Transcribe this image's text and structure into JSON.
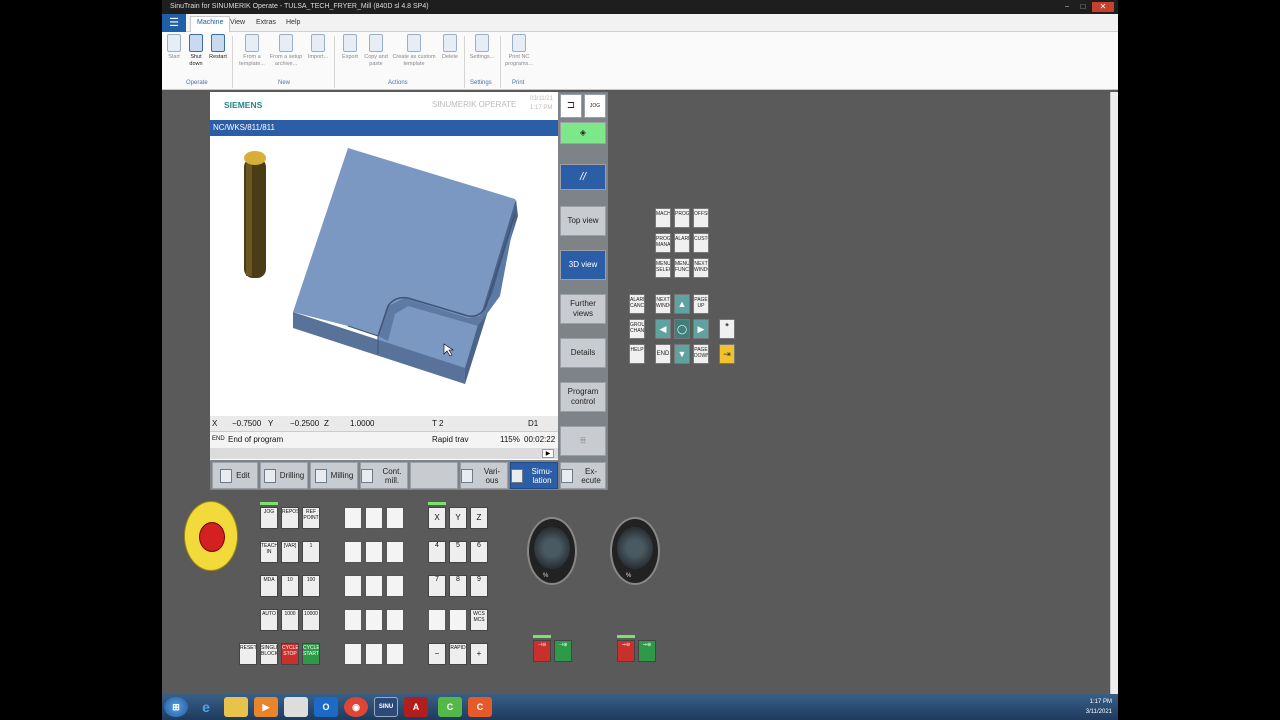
{
  "window": {
    "title": "SinuTrain for SINUMERIK Operate - TULSA_TECH_FRYER_Mill (840D sl 4.8 SP4)"
  },
  "menu": {
    "tabs": [
      "Machine",
      "View",
      "Extras",
      "Help"
    ]
  },
  "ribbon": {
    "buttons": [
      {
        "label": "Start"
      },
      {
        "label": "Shut down"
      },
      {
        "label": "Restart"
      },
      {
        "label": "From a template..."
      },
      {
        "label": "From a setup archive..."
      },
      {
        "label": "Import..."
      },
      {
        "label": "Export"
      },
      {
        "label": "Copy and paste"
      },
      {
        "label": "Create as custom template"
      },
      {
        "label": "Delete"
      },
      {
        "label": "Settings..."
      },
      {
        "label": "Print NC programs..."
      }
    ],
    "groups": [
      "Operate",
      "New",
      "Actions",
      "Settings",
      "Print"
    ]
  },
  "hmi": {
    "brand": "SIEMENS",
    "product": "SINUMERIK OPERATE",
    "date": "03/11/21",
    "time": "1:17 PM",
    "path": "NC/WKS/811/811",
    "status_line1": {
      "x": "X",
      "x_val": "−0.7500",
      "y": "Y",
      "y_val": "−0.2500",
      "z": "Z",
      "z_val": "1.0000",
      "tool": "T 2",
      "d": "D1"
    },
    "status_line2": {
      "end": "END",
      "msg": "End of program",
      "mode": "Rapid trav",
      "feed": "115%",
      "time": "00:02:22"
    },
    "hsoft": [
      "Edit",
      "Drilling",
      "Milling",
      "Cont. mill.",
      "",
      "Vari- ous",
      "Simu- lation",
      "Ex- ecute"
    ],
    "vsoft": [
      "",
      "//",
      "Top view",
      "3D view",
      "Further views",
      "Details",
      "Program control",
      ""
    ]
  },
  "keypad": {
    "top": [
      "MACHINE",
      "PROGRAM",
      "OFFSET",
      "PROGRAM MANAGER",
      "ALARM",
      "CUSTOM",
      "MENU SELECT",
      "MENU FUNCTION",
      "NEXT WINDOW"
    ],
    "middle": [
      "ALARM CANCEL",
      "NEXT WINDOW",
      "PAGE UP",
      "GROUP CHANNEL",
      "SELECT",
      "PAGE DOWN",
      "HELP",
      "END",
      "INPUT"
    ]
  },
  "machine_panel": {
    "left_keys": [
      "JOG",
      "REPOS",
      "REF POINT",
      "TEACH IN",
      "[VAR]",
      "1",
      "MDA",
      "10",
      "100",
      "AUTO",
      "1000",
      "10000",
      "RESET",
      "SINGLE BLOCK",
      "CYCLE STOP",
      "CYCLE START"
    ],
    "axis_keys": [
      "X",
      "Y",
      "Z",
      "4",
      "5",
      "6",
      "7",
      "8",
      "9",
      "WCS MCS",
      "−",
      "RAPID",
      "+"
    ],
    "override1_label": "% ",
    "override2_label": "% "
  },
  "taskbar": {
    "clock_time": "1:17 PM",
    "clock_date": "3/11/2021"
  },
  "colors": {
    "siemens_teal": "#1e8a8a",
    "hmi_blue": "#2b5ea7",
    "workpiece": "#6d8db8"
  }
}
